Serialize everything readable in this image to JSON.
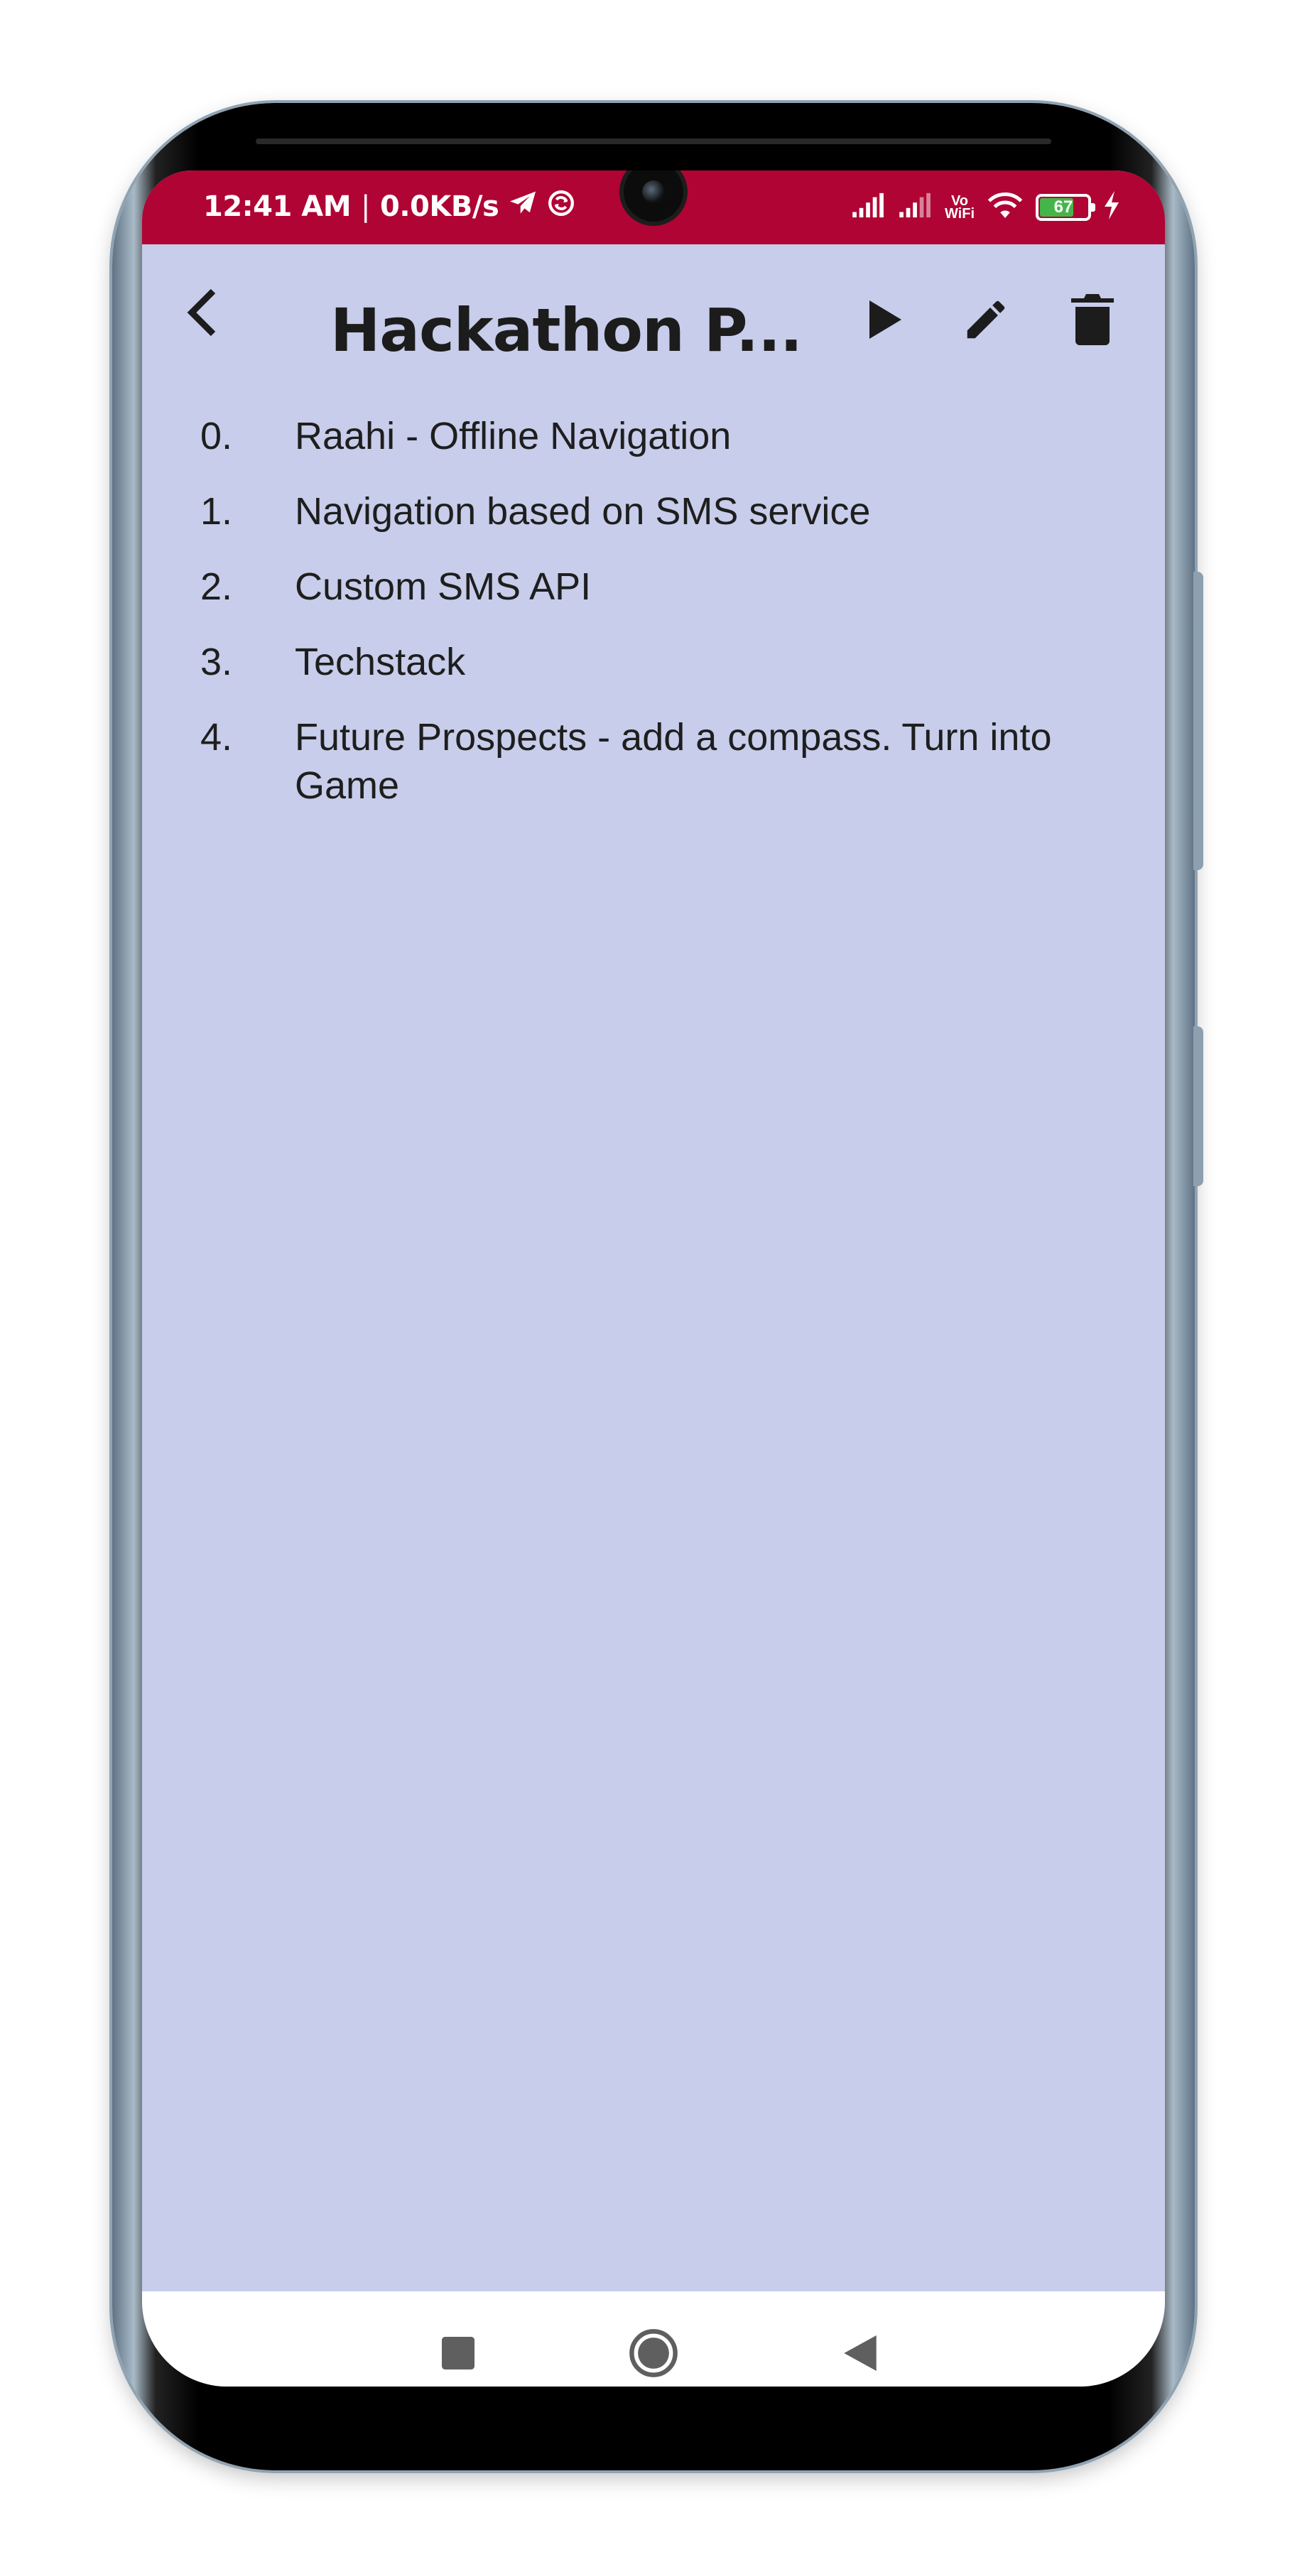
{
  "status_bar": {
    "time": "12:41 AM",
    "separator": "|",
    "data_speed": "0.0KB/s",
    "vowifi_top": "Vo",
    "vowifi_bottom": "WiFi",
    "battery": "67",
    "background": "#b00434"
  },
  "app_bar": {
    "title": "Hackathon P..."
  },
  "note": {
    "items": [
      {
        "number": "0.",
        "text": "Raahi - Offline Navigation"
      },
      {
        "number": "1.",
        "text": "Navigation based on SMS service"
      },
      {
        "number": "2.",
        "text": "Custom SMS API"
      },
      {
        "number": "3.",
        "text": "Techstack"
      },
      {
        "number": "4.",
        "text": "Future Prospects - add a compass. Turn into Game"
      }
    ]
  },
  "colors": {
    "screen_background": "#c7cdea",
    "accent": "#b00434",
    "text": "#1e1e1e"
  }
}
